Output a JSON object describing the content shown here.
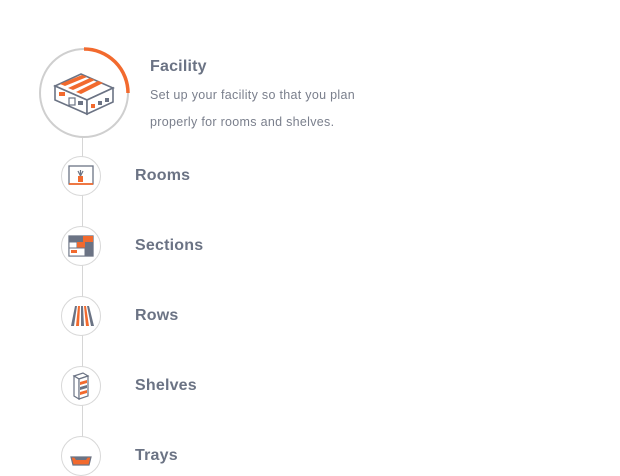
{
  "colors": {
    "accent": "#f26a2e",
    "icon_gray": "#6b7384",
    "line_gray": "#d6d6d6",
    "text": "#6b7384"
  },
  "active_step": {
    "title": "Facility",
    "description": "Set up your facility so that you plan properly for rooms and shelves.",
    "icon": "facility-icon",
    "progress": 0.25
  },
  "steps": [
    {
      "label": "Rooms",
      "icon": "room-icon"
    },
    {
      "label": "Sections",
      "icon": "sections-icon"
    },
    {
      "label": "Rows",
      "icon": "rows-icon"
    },
    {
      "label": "Shelves",
      "icon": "shelves-icon"
    },
    {
      "label": "Trays",
      "icon": "tray-icon"
    }
  ]
}
